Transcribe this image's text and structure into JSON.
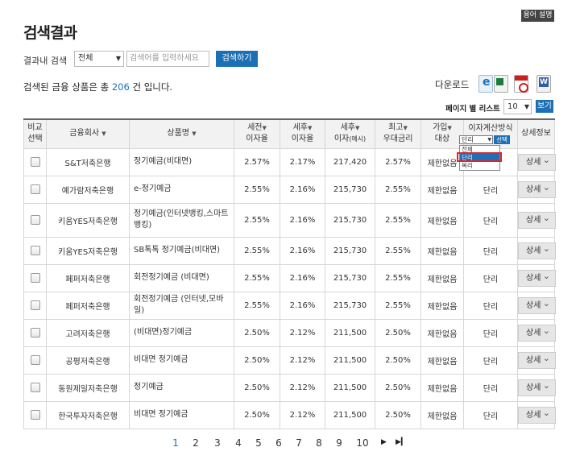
{
  "glossary_button": "용어 설명",
  "page_title": "검색결과",
  "search": {
    "label": "결과내 검색",
    "scope_value": "전체",
    "placeholder": "검색어를 입력하세요",
    "button": "검색하기"
  },
  "result_summary": {
    "prefix": "검색된 금융 상품은 총 ",
    "count": "206",
    "suffix": " 건 입니다."
  },
  "download": {
    "label": "다운로드",
    "icons": [
      "ie-icon",
      "excel-icon",
      "pdf-icon",
      "word-icon"
    ]
  },
  "list_per_page": {
    "label": "페이지 별 리스트 :",
    "value": "10",
    "button": "보기"
  },
  "table": {
    "headers": {
      "compare": [
        "비교",
        "선택"
      ],
      "company": "금융회사",
      "product": "상품명",
      "pretax_rate": [
        "세전",
        "이자율"
      ],
      "aftertax_rate": [
        "세후",
        "이자율"
      ],
      "aftertax_interest": [
        "세후",
        "이자",
        "(예시)"
      ],
      "max_rate": [
        "최고",
        "우대금리"
      ],
      "eligibility": [
        "가입",
        "대상"
      ],
      "interest_method": "이자계산방식",
      "detail": "상세정보"
    },
    "interest_method_filter": {
      "value": "단리",
      "button": "선택",
      "options": [
        "전체",
        "단리",
        "복리"
      ],
      "highlighted": "단리"
    },
    "rows": [
      {
        "company": "S&T저축은행",
        "product": "정기예금(비대면)",
        "pretax": "2.57%",
        "aftertax": "2.17%",
        "interest": "217,420",
        "max": "2.57%",
        "eligibility": "제한없음",
        "method": "",
        "detail": "상세"
      },
      {
        "company": "예가람저축은행",
        "product": "e-정기예금",
        "pretax": "2.55%",
        "aftertax": "2.16%",
        "interest": "215,730",
        "max": "2.55%",
        "eligibility": "제한없음",
        "method": "단리",
        "detail": "상세"
      },
      {
        "company": "키움YES저축은행",
        "product": "정기예금(인터넷뱅킹,스마트뱅킹)",
        "pretax": "2.55%",
        "aftertax": "2.16%",
        "interest": "215,730",
        "max": "2.55%",
        "eligibility": "제한없음",
        "method": "단리",
        "detail": "상세"
      },
      {
        "company": "키움YES저축은행",
        "product": "SB톡톡 정기예금(비대면)",
        "pretax": "2.55%",
        "aftertax": "2.16%",
        "interest": "215,730",
        "max": "2.55%",
        "eligibility": "제한없음",
        "method": "단리",
        "detail": "상세"
      },
      {
        "company": "페퍼저축은행",
        "product": "회전정기예금 (비대면)",
        "pretax": "2.55%",
        "aftertax": "2.16%",
        "interest": "215,730",
        "max": "2.55%",
        "eligibility": "제한없음",
        "method": "단리",
        "detail": "상세"
      },
      {
        "company": "페퍼저축은행",
        "product": "회전정기예금 (인터넷,모바일)",
        "pretax": "2.55%",
        "aftertax": "2.16%",
        "interest": "215,730",
        "max": "2.55%",
        "eligibility": "제한없음",
        "method": "단리",
        "detail": "상세"
      },
      {
        "company": "고려저축은행",
        "product": "(비대면)정기예금",
        "pretax": "2.50%",
        "aftertax": "2.12%",
        "interest": "211,500",
        "max": "2.50%",
        "eligibility": "제한없음",
        "method": "단리",
        "detail": "상세"
      },
      {
        "company": "공평저축은행",
        "product": "비대면 정기예금",
        "pretax": "2.50%",
        "aftertax": "2.12%",
        "interest": "211,500",
        "max": "2.50%",
        "eligibility": "제한없음",
        "method": "단리",
        "detail": "상세"
      },
      {
        "company": "동원제일저축은행",
        "product": "정기예금",
        "pretax": "2.50%",
        "aftertax": "2.12%",
        "interest": "211,500",
        "max": "2.50%",
        "eligibility": "제한없음",
        "method": "단리",
        "detail": "상세"
      },
      {
        "company": "한국투자저축은행",
        "product": "비대면 정기예금",
        "pretax": "2.50%",
        "aftertax": "2.12%",
        "interest": "211,500",
        "max": "2.50%",
        "eligibility": "제한없음",
        "method": "단리",
        "detail": "상세"
      }
    ]
  },
  "pagination": {
    "pages": [
      "1",
      "2",
      "3",
      "4",
      "5",
      "6",
      "7",
      "8",
      "9",
      "10"
    ],
    "current": "1",
    "next": "▶",
    "last": "▶▎"
  }
}
